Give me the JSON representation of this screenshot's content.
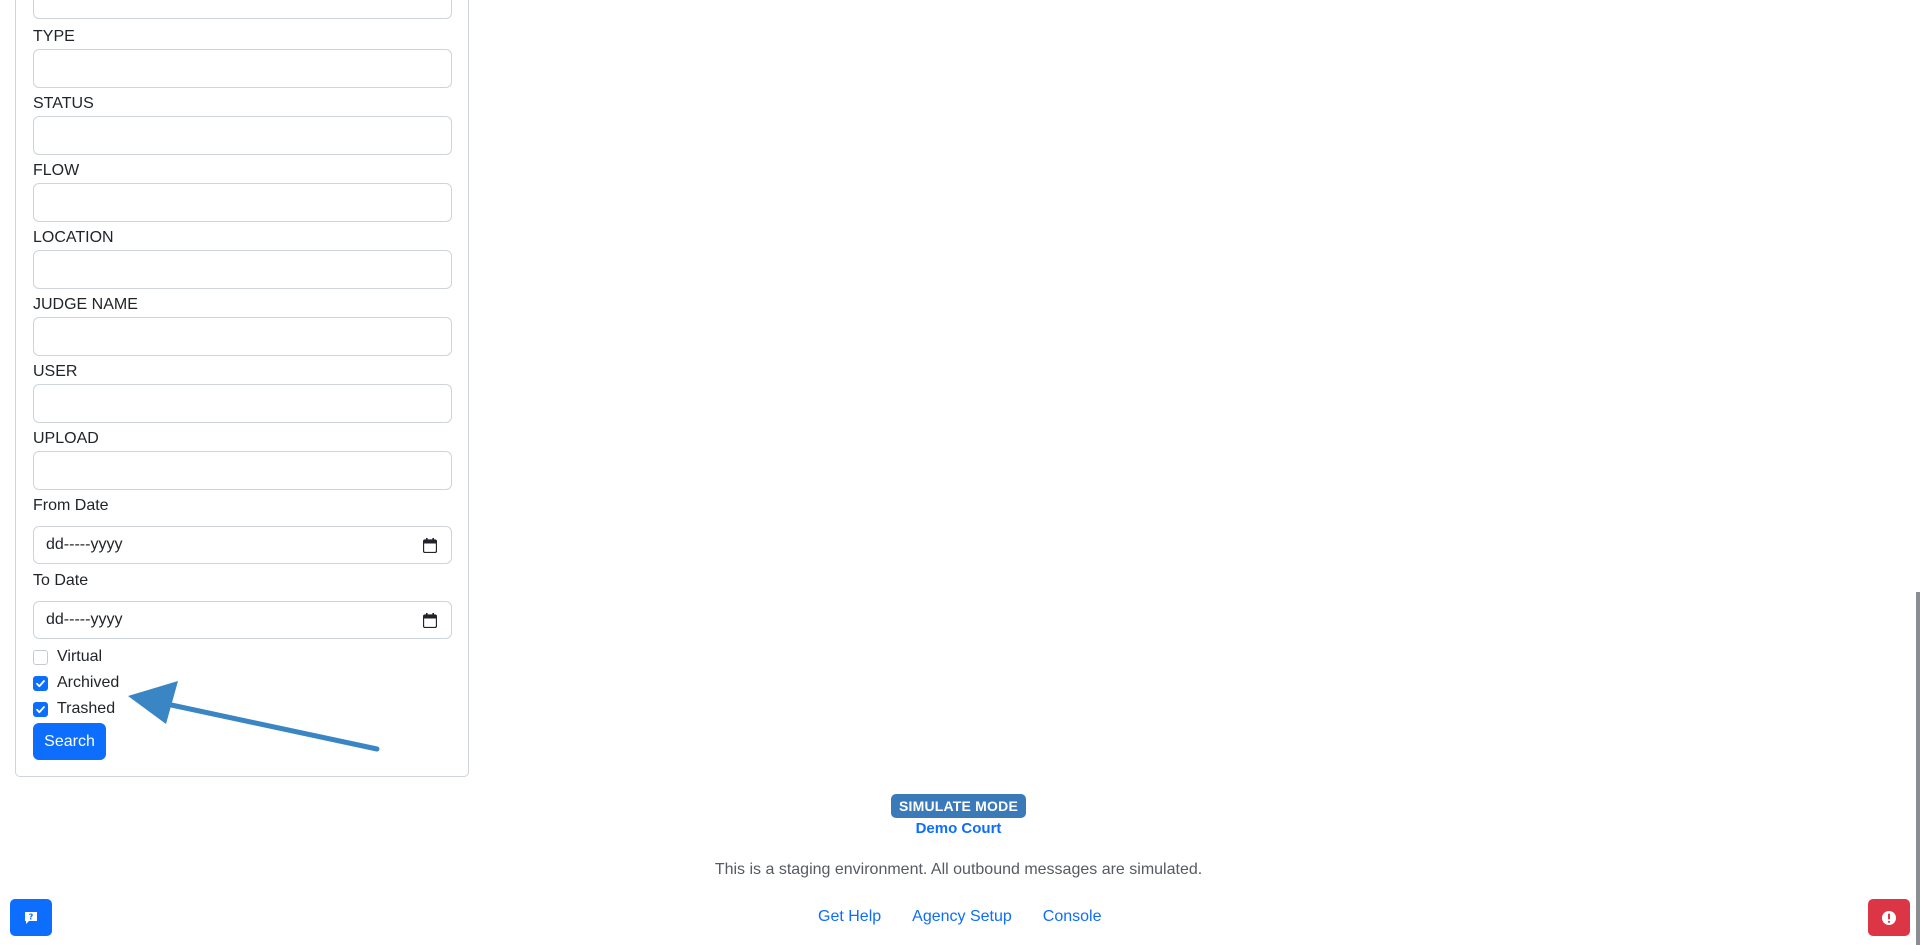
{
  "filters": {
    "fields": [
      {
        "label": "TYPE",
        "value": ""
      },
      {
        "label": "STATUS",
        "value": ""
      },
      {
        "label": "FLOW",
        "value": ""
      },
      {
        "label": "LOCATION",
        "value": ""
      },
      {
        "label": "JUDGE NAME",
        "value": ""
      },
      {
        "label": "USER",
        "value": ""
      },
      {
        "label": "UPLOAD",
        "value": ""
      }
    ],
    "from_date": {
      "label": "From Date",
      "placeholder": "dd-----yyyy"
    },
    "to_date": {
      "label": "To Date",
      "placeholder": "dd-----yyyy"
    },
    "checkboxes": [
      {
        "label": "Virtual",
        "checked": false
      },
      {
        "label": "Archived",
        "checked": true
      },
      {
        "label": "Trashed",
        "checked": true
      }
    ],
    "search_label": "Search"
  },
  "footer": {
    "badge": "SIMULATE MODE",
    "court": "Demo Court",
    "note": "This is a staging environment. All outbound messages are simulated.",
    "links": [
      "Get Help",
      "Agency Setup",
      "Console"
    ]
  },
  "icons": {
    "calendar": "calendar-icon",
    "help": "help-chat-icon",
    "alert": "alert-icon",
    "check": "check-icon"
  },
  "colors": {
    "primary": "#0d6efd",
    "badge": "#3a7ab8",
    "danger": "#dc3545",
    "arrow": "#3a85c4"
  }
}
